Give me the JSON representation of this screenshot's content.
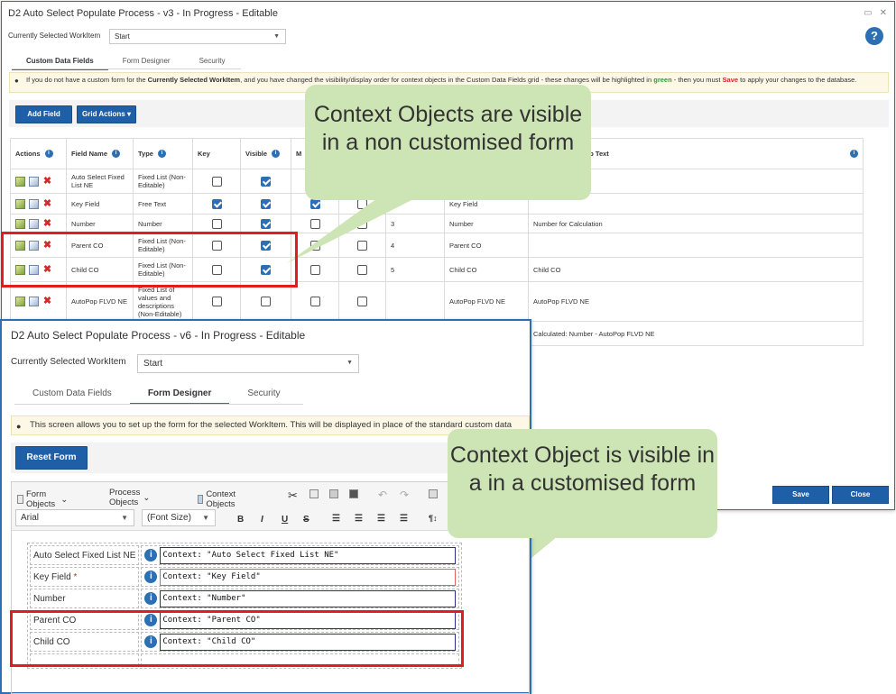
{
  "window1": {
    "title": "D2 Auto Select Populate Process - v3 - In Progress - Editable",
    "workitem_label": "Currently Selected WorkItem",
    "workitem_value": "Start",
    "help_label": "?",
    "tabs": [
      {
        "label": "Custom Data Fields",
        "active": true
      },
      {
        "label": "Form Designer",
        "active": false
      },
      {
        "label": "Security",
        "active": false
      }
    ],
    "notice": {
      "part1": "If you do not have a custom form for the ",
      "bold1": "Currently Selected WorkItem",
      "part2": ", and you have changed the visibility/display order for context objects in the Custom Data Fields grid - these changes will be highlighted in ",
      "green": "green",
      "part3": " - then you must ",
      "save": "Save",
      "part4": " to apply your changes to the database."
    },
    "add_field_label": "Add Field",
    "grid_actions_label": "Grid Actions",
    "columns": {
      "actions": "Actions",
      "field_name": "Field Name",
      "type": "Type",
      "key": "Key",
      "visible": "Visible",
      "m": "M",
      "help_text": "elp Text"
    },
    "rows": [
      {
        "field_name": "Auto Select Fixed List NE",
        "type": "Fixed List (Non-Editable)",
        "key": false,
        "visible": true,
        "m": false,
        "order": "",
        "label": "",
        "help": ""
      },
      {
        "field_name": "Key Field",
        "type": "Free Text",
        "key": true,
        "visible": true,
        "m": true,
        "order": "",
        "label": "Key Field",
        "help": ""
      },
      {
        "field_name": "Number",
        "type": "Number",
        "key": false,
        "visible": true,
        "m": false,
        "order": "3",
        "label": "Number",
        "help": "Number for Calculation"
      },
      {
        "field_name": "Parent CO",
        "type": "Fixed List (Non-Editable)",
        "key": false,
        "visible": true,
        "m": false,
        "order": "4",
        "label": "Parent CO",
        "help": ""
      },
      {
        "field_name": "Child CO",
        "type": "Fixed List (Non-Editable)",
        "key": false,
        "visible": true,
        "m": false,
        "order": "5",
        "label": "Child CO",
        "help": "Child CO"
      },
      {
        "field_name": "AutoPop FLVD NE",
        "type": "Fixed List of values and descriptions (Non-Editable)",
        "key": false,
        "visible": false,
        "m": false,
        "order": "",
        "label": "AutoPop FLVD NE",
        "help": "AutoPop FLVD NE"
      }
    ],
    "extra_help": "Calculated: Number - AutoPop FLVD NE",
    "save_label": "Save",
    "close_label": "Close"
  },
  "window2": {
    "title": "D2 Auto Select Populate Process - v6 - In Progress - Editable",
    "workitem_label": "Currently Selected WorkItem",
    "workitem_value": "Start",
    "tabs": [
      {
        "label": "Custom Data Fields",
        "active": false
      },
      {
        "label": "Form Designer",
        "active": true
      },
      {
        "label": "Security",
        "active": false
      }
    ],
    "notice": "This screen allows you to set up the form for the selected WorkItem. This will be displayed in place of the standard custom data",
    "reset_label": "Reset Form",
    "toolbar": {
      "form_objects": "Form Objects",
      "process_objects": "Process Objects",
      "context_objects": "Context Objects"
    },
    "font_value": "Arial",
    "font_size_value": "(Font Size)",
    "format": {
      "bold": "B",
      "italic": "I",
      "underline": "U",
      "strike": "S"
    },
    "form_rows": [
      {
        "label": "Auto Select Fixed List NE",
        "required": false,
        "value": "Context: \"Auto Select Fixed List NE\""
      },
      {
        "label": "Key Field",
        "required": true,
        "value": "Context: \"Key Field\""
      },
      {
        "label": "Number",
        "required": false,
        "value": "Context: \"Number\""
      },
      {
        "label": "Parent CO",
        "required": false,
        "value": "Context: \"Parent CO\""
      },
      {
        "label": "Child CO",
        "required": false,
        "value": "Context: \"Child CO\""
      }
    ]
  },
  "callouts": {
    "top": "Context Objects are visible in a non customised form",
    "bottom": "Context Object is visible in a in a customised form"
  },
  "colors": {
    "accent": "#1f5fa8",
    "callout": "#cde4b4",
    "highlight": "#e11d1d"
  }
}
